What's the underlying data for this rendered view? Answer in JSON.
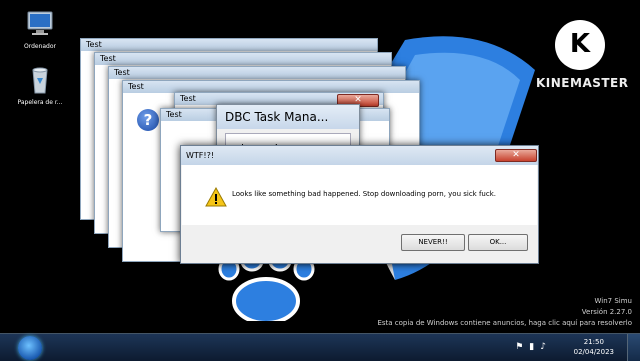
{
  "desktop": {
    "icons": [
      {
        "label": "Ordenador",
        "icon": "computer-icon"
      },
      {
        "label": "Papelera de r...",
        "icon": "recycle-bin-icon"
      }
    ],
    "overlay_brand": "KINEMASTER",
    "overlay_logo_letter": "K",
    "watermark_lines": [
      "Win7 Simu",
      "Versión 2.27.0",
      "Esta copia de Windows contiene anuncios, haga clic aquí para resolverlo"
    ]
  },
  "stacked_windows": [
    {
      "title": "Test"
    },
    {
      "title": "Test"
    },
    {
      "title": "Test"
    },
    {
      "title": "Test"
    },
    {
      "title": "Test"
    },
    {
      "title": "Test"
    }
  ],
  "stacked_fragment_text": "Te",
  "dbc_window": {
    "title": "DBC Task Mana...",
    "text": "whoops!"
  },
  "dialog": {
    "title": "WTF!?!",
    "message": "Looks like something bad happened. Stop downloading porn, you sick fuck.",
    "buttons": {
      "never": "NEVER!!",
      "ok": "OK..."
    },
    "close_glyph": "✕"
  },
  "taskbar": {
    "time": "21:50",
    "date": "02/04/2023",
    "tray_icons": [
      "flag-icon",
      "signal-icon",
      "speaker-icon"
    ]
  },
  "colors": {
    "close_red": "#c7422e",
    "title_blue": "#c4d5e8",
    "shield_blue": "#2d7fe0"
  }
}
